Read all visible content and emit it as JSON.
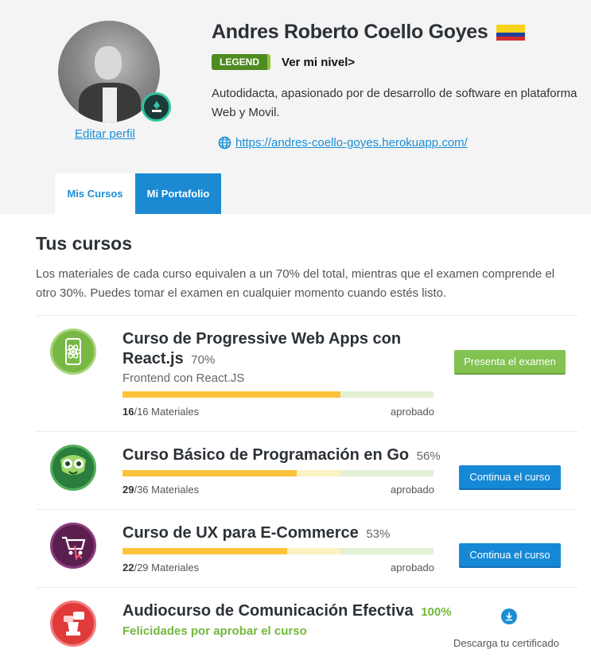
{
  "profile": {
    "name": "Andres Roberto Coello Goyes",
    "badge": "LEGEND",
    "level_link": "Ver mi nivel>",
    "bio_line1": "Autodidacta, apasionado por de desarrollo de software en plataforma",
    "bio_line2": "Web y Movil.",
    "website": "https://andres-coello-goyes.herokuapp.com/",
    "edit_profile": "Editar perfil",
    "flag_colors": [
      "#f7d21d",
      "#1f3f9c",
      "#d52b2b"
    ]
  },
  "tabs": [
    {
      "label": "Mis Cursos",
      "active": true
    },
    {
      "label": "Mi Portafolio",
      "active": false
    }
  ],
  "section": {
    "title": "Tus cursos",
    "description": "Los materiales de cada curso equivalen a un 70% del total, mientras que el examen comprende el otro 30%. Puedes tomar el examen en cualquier momento cuando estés listo."
  },
  "courses": [
    {
      "title": "Curso de Progressive Web Apps con React.js",
      "percent": "70%",
      "subtitle": "Frontend con React.JS",
      "progress": 0.7,
      "materials_done": "16",
      "materials_total": "/16",
      "materials_label": "Materiales",
      "status": "aprobado",
      "button": "Presenta el examen",
      "icon": "react-icon"
    },
    {
      "title": "Curso Básico de Programación en Go",
      "percent": "56%",
      "progress": 0.56,
      "materials_done": "29",
      "materials_total": "/36",
      "materials_label": "Materiales",
      "status": "aprobado",
      "button": "Continua el curso",
      "icon": "go-gopher-icon"
    },
    {
      "title": "Curso de UX para E-Commerce",
      "percent": "53%",
      "progress": 0.53,
      "materials_done": "22",
      "materials_total": "/29",
      "materials_label": "Materiales",
      "status": "aprobado",
      "button": "Continua el curso",
      "icon": "shopping-cart-icon"
    },
    {
      "title": "Audiocurso de Comunicación Efectiva",
      "percent": "100%",
      "congrats": "Felicidades por aprobar el curso",
      "certificate": "Descarga tu certificado",
      "icon": "chess-rook-icon"
    }
  ],
  "colors": {
    "accent_blue": "#1a8fd6",
    "accent_green": "#82c251",
    "progress_yellow": "#fdc33b",
    "badge_green": "#4e8b21"
  }
}
